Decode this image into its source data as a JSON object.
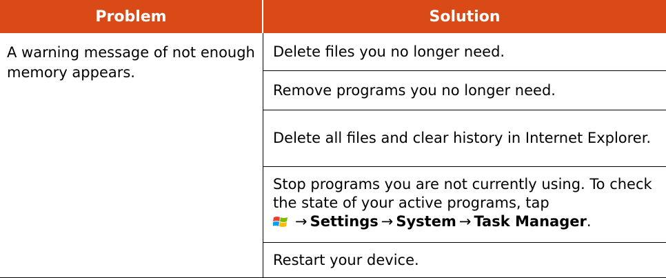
{
  "table": {
    "header": {
      "problem_label": "Problem",
      "solution_label": "Solution",
      "header_color": "#d94a16"
    },
    "problem_text": "A warning message of not enough memory appears.",
    "solutions": [
      "Delete files you no longer need.",
      "Remove programs you no longer need.",
      "Delete all files and clear history in Internet Explorer.",
      "Stop programs you are not currently using. To check the state of your active programs, tap",
      "Restart your device."
    ],
    "nav_path": {
      "icon": "windows-start-icon",
      "arrow": "→",
      "step1": "Settings",
      "step2": "System",
      "step3": "Task Manager",
      "end": "."
    }
  }
}
